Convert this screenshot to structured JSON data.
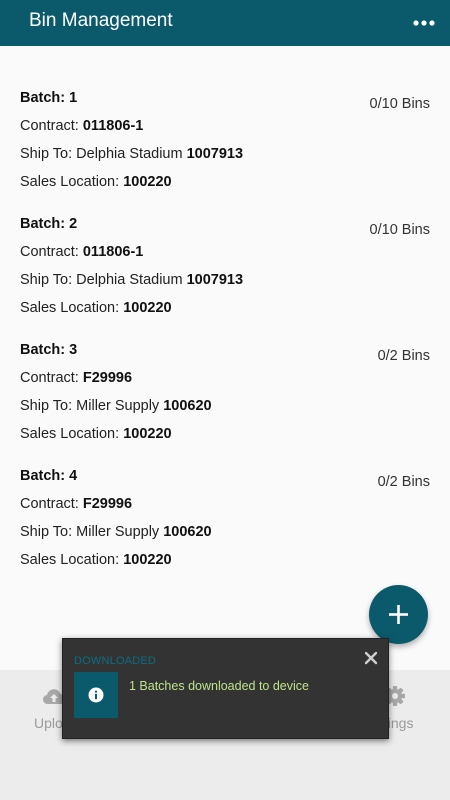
{
  "header": {
    "title": "Bin Management",
    "more_icon": "more-horizontal-icon"
  },
  "labels": {
    "contract": "Contract: ",
    "ship_to": "Ship To: ",
    "sales_location": "Sales Location: "
  },
  "batches": [
    {
      "batch": "Batch: 1",
      "contract": "011806-1",
      "ship_to_name": "Delphia Stadium ",
      "ship_to_code": "1007913",
      "sales_location": "100220",
      "bins": "0/10 Bins"
    },
    {
      "batch": "Batch: 2",
      "contract": "011806-1",
      "ship_to_name": "Delphia Stadium ",
      "ship_to_code": "1007913",
      "sales_location": "100220",
      "bins": "0/10 Bins"
    },
    {
      "batch": "Batch: 3",
      "contract": "F29996",
      "ship_to_name": "Miller Supply ",
      "ship_to_code": "100620",
      "sales_location": "100220",
      "bins": "0/2 Bins"
    },
    {
      "batch": "Batch: 4",
      "contract": "F29996",
      "ship_to_name": "Miller Supply ",
      "ship_to_code": "100620",
      "sales_location": "100220",
      "bins": "0/2 Bins"
    }
  ],
  "fab": {
    "icon": "plus-icon"
  },
  "bottom_nav": {
    "upload_label": "Uplo",
    "upload_icon": "cloud-upload-icon",
    "settings_label": "ttings",
    "settings_icon": "gear-icon"
  },
  "toast": {
    "title": "DOWNLOADED",
    "message": "1 Batches downloaded to device",
    "icon": "info-icon",
    "close_icon": "close-icon"
  },
  "colors": {
    "primary": "#0a5a6b",
    "toast_bg": "#333333",
    "toast_title": "#0a6e84",
    "toast_message": "#bfe38b"
  }
}
